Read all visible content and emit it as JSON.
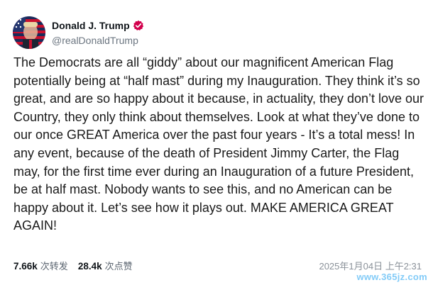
{
  "post": {
    "author": {
      "display_name": "Donald J. Trump",
      "handle": "@realDonaldTrump",
      "verified": true,
      "avatar_icon": "flag-portrait-avatar"
    },
    "text": "The Democrats are all “giddy” about our magnificent American Flag potentially being at “half mast” during my Inauguration. They think it’s so great, and are so happy about it because, in actuality, they don’t love our Country, they only think about themselves. Look at what they’ve done to our once GREAT America over the past four years - It’s a total mess! In any event, because of the death of President Jimmy Carter, the Flag may, for the first time ever during an Inauguration of a future President, be at half mast. Nobody wants to see this, and no American can be happy about it. Let’s see how it plays out. MAKE AMERICA GREAT AGAIN!",
    "stats": {
      "reposts_count": "7.66k",
      "reposts_label": "次转发",
      "likes_count": "28.4k",
      "likes_label": "次点赞"
    },
    "timestamp": "2025年1月04日 上午2:31"
  },
  "watermark": "www.365jz.com",
  "colors": {
    "verified_badge": "#d2004c",
    "text": "#1a1a1a",
    "muted": "#6b7580"
  }
}
